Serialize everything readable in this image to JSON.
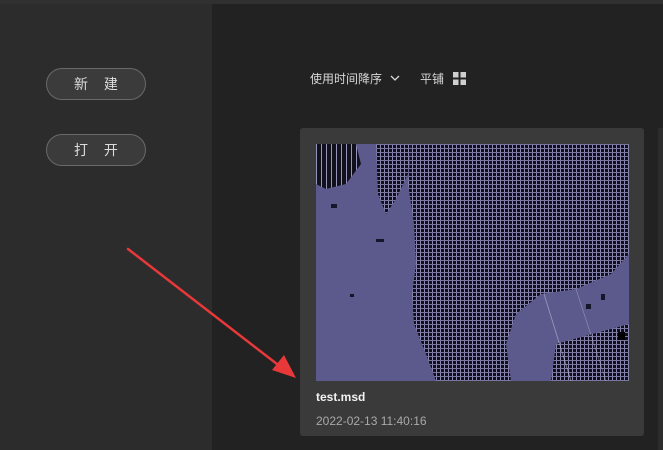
{
  "sidebar": {
    "new_label": "新 建",
    "open_label": "打 开"
  },
  "toolbar": {
    "sort_label": "使用时间降序",
    "tile_label": "平铺"
  },
  "files": [
    {
      "name": "test.msd",
      "date": "2022-02-13 11:40:16"
    }
  ],
  "colors": {
    "background": "#222222",
    "sidebar": "#2c2c2c",
    "card": "#3a3a3a",
    "map_water": "#5c5a8c",
    "annotation_arrow": "#e8383a"
  },
  "icons": {
    "sort": "chevron-down-icon",
    "tile": "grid-icon"
  }
}
